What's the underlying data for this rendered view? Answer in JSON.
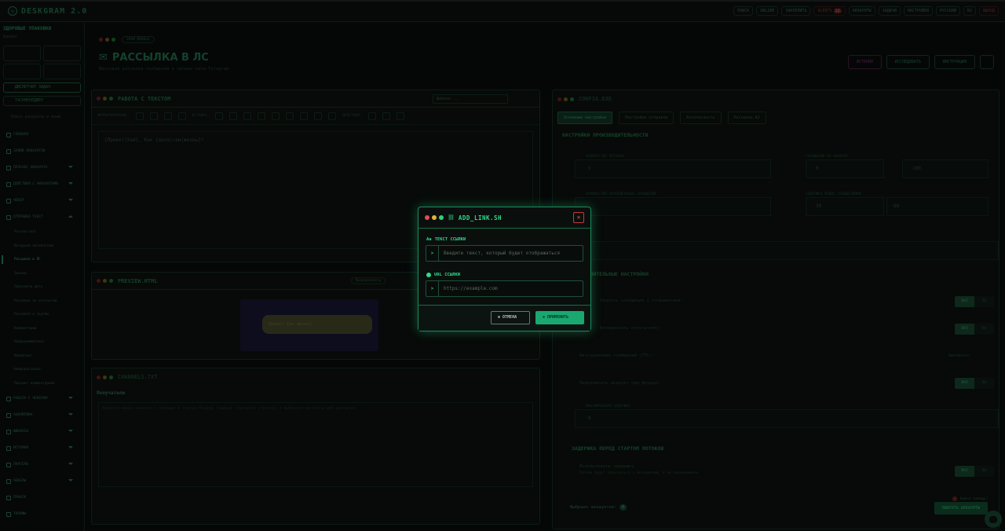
{
  "app": {
    "title": "DESKGRAM 2.0"
  },
  "topbar": {
    "items": [
      "ПОИСК",
      "ONLINE",
      "ЗАКРЕПИТЬ",
      "АККАУНТЫ",
      "ЗАДАЧИ",
      "НАСТРОЙКИ",
      "РУССКИЙ",
      "RU"
    ],
    "alerts_label": "ALERTS",
    "alerts_count": "12",
    "exit_label": "ВЫХОД"
  },
  "sidebar": {
    "account_name": "ЗДОРОВЫЕ УПАКОВКИ",
    "balance_label": "Баланс",
    "search_placeholder": "Поиск разделов и меню",
    "btn_primary": "ДИСПЕТЧЕР ЗАДАЧ",
    "btn_secondary": "ТАСКМЕНЕДЖЕР",
    "menu": [
      {
        "label": "ГЛАВНАЯ"
      },
      {
        "label": "ЗАЛИВ АККАУНТОВ"
      },
      {
        "label": "ПЕРЕНОС АККАУНТА"
      },
      {
        "label": "ДЕЙСТВИЯ С АККАУНТАМИ"
      },
      {
        "label": "ЧЕКЕР"
      },
      {
        "label": "ОТПРАВКА ТЕКСТ"
      }
    ],
    "submenu": [
      "Автопостинг",
      "Вечерний автопостинг",
      "Рассылка в ЛС",
      "Звонки",
      "Пересмотр фото",
      "Рассылка по контактам",
      "Рассылка в группы",
      "Комментарии",
      "Нейрокомментинг",
      "Инвайтинг",
      "Нейрорассылка",
      "Парсинг комментариев"
    ],
    "menu_bottom": [
      "РАБОТА С ЧЕКЕРОМ",
      "АНАЛИТИКА",
      "ФИНАНСЫ",
      "ИСТОРИЯ",
      "ПАРСЕРЫ",
      "ЧЕКЕРЫ",
      "ПРОКСИ",
      "ТАРИФЫ"
    ]
  },
  "page": {
    "crumb": "SPAM MODULE",
    "title": "РАССЫЛКА В ЛС",
    "subtitle": "Массовая рассылка сообщений в личные чаты Telegram",
    "btn_history": "ИСТОРИЯ",
    "btn_research": "ИССЛЕДОВАТЬ",
    "btn_instruction": "ИНСТРУКЦИЯ"
  },
  "editor": {
    "title": "РАБОТА С ТЕКСТОМ",
    "template_label": "Шаблон ...",
    "format_label": "ФОРМАТИРОВАНИЕ:",
    "insert_label": "ВСТАВКА:",
    "actions_label": "ДЕЙСТВИЯ:",
    "content": "{Привет|Хай}, Как {дела|сам|жизнь}?"
  },
  "preview": {
    "title": "PREVIEW.HTML",
    "badge": "Предпросмотр",
    "message": "Привет Как жизнь?"
  },
  "recipients": {
    "file": "CHANNELS.TXT",
    "title": "Получатели",
    "placeholder": "Введите имена каналов с помощью в списке Подряд (каждый отдельной строкой) и выберите аккаунты для рассылки"
  },
  "config": {
    "file": "CONFIG.EXE",
    "tabs": [
      "Основные настройки",
      "Настройки отправки",
      "Безопасность",
      "Рассылка AI"
    ],
    "section_perf": "НАСТРОЙКИ ПРОИЗВОДИТЕЛЬНОСТИ",
    "threads_label": "КОЛИЧЕСТВО ПОТОКОВ",
    "threads_value": "5",
    "msgs_label": "СООБЩЕНИЯ НА АККАУНТ",
    "msgs_from": "0",
    "msgs_to": "100",
    "parallel_label": "КОЛИЧЕСТВО ПАРАЛЛЕЛЬНЫХ СООБЩЕНИЙ",
    "delay_label": "ЗАДЕРЖКА МЕЖДУ СООБЩЕНИЯМИ",
    "delay_from": "30",
    "delay_to": "60",
    "section_extra": "ДОПОЛНИТЕЛЬНЫЕ НАСТРОЙКИ",
    "opt_delete": "Удалять сообщения у отправителя:",
    "opt_block": "Блокировать получателя:",
    "opt_ttl": "Автоудаление сообщений (TTL):",
    "ttl_value": "Выключено",
    "opt_switch": "Переключать аккаунт при флудах:",
    "max_delay_label": "МАКСИМАЛЬНАЯ ЗАДЕРЖКА",
    "max_delay_value": "0",
    "on": "ВКЛ",
    "off": "ВЫ",
    "section_start": "ЗАДЕРЖКА ПЕРЕД СТАРТОМ ПОТОКОВ",
    "use_delay": "Использовать задержку",
    "use_delay_hint": "Потоки будут запускаться с интервалом, а не одновременно",
    "selected_label": "Выбрано аккаунтов:",
    "selected_count": "0",
    "select_btn": "ВЫБРАТЬ АККАУНТЫ",
    "help": "Нужна помощь?"
  },
  "modal": {
    "title": "ADD_LINK.SH",
    "text_label": "ТЕКСТ ССЫЛКИ",
    "text_placeholder": "Введите текст, который будет отображаться",
    "url_label": "URL ССЫЛКИ",
    "url_placeholder": "https://example.com",
    "prompt": ">",
    "close": "✕",
    "cancel": "ОТМЕНА",
    "apply": "ПРИМЕНИТЬ"
  },
  "colors": {
    "accent": "#2fd98a",
    "apply_bg": "#1aa870",
    "close": "#e05555"
  }
}
